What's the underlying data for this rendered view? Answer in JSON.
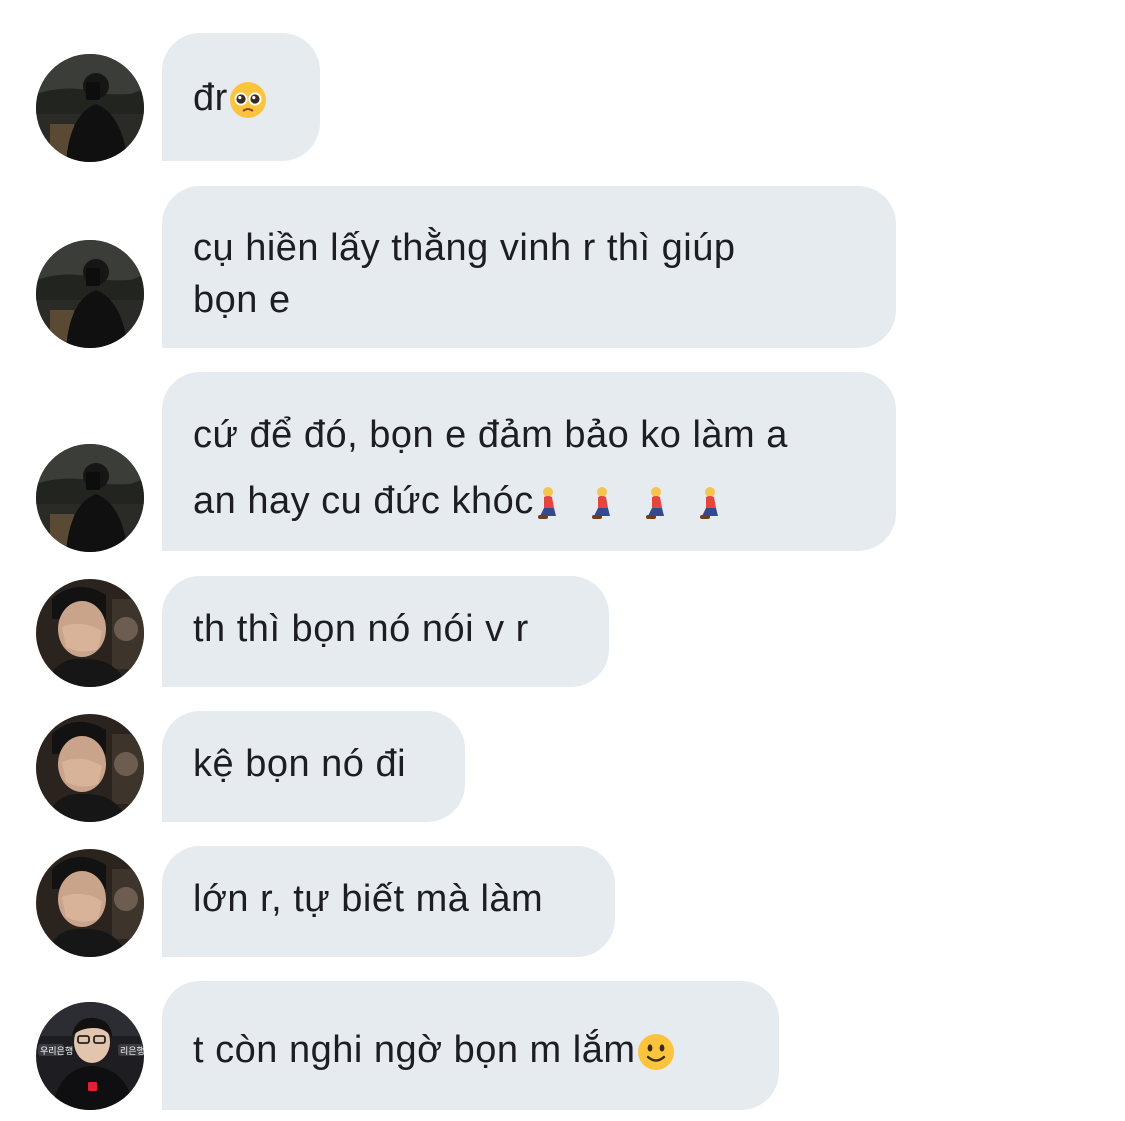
{
  "conversation": {
    "messages": [
      {
        "sender": "avatar-dark-night",
        "lines": [
          "đr"
        ],
        "emoji": "pleading-face-emoji"
      },
      {
        "sender": "avatar-dark-night",
        "lines": [
          "cụ hiền lấy thằng vinh r thì giúp",
          "bọn e"
        ]
      },
      {
        "sender": "avatar-dark-night",
        "lines": [
          "cứ để đó, bọn e đảm bảo ko làm a",
          "an hay cu đức khóc"
        ],
        "emoji": "person-kneeling-emoji",
        "emoji_count": 4
      },
      {
        "sender": "avatar-face-covered",
        "lines": [
          "th thì bọn nó nói v r"
        ]
      },
      {
        "sender": "avatar-face-covered",
        "lines": [
          "kệ bọn nó đi"
        ]
      },
      {
        "sender": "avatar-face-covered",
        "lines": [
          "lớn r, tự biết mà làm"
        ]
      },
      {
        "sender": "avatar-player-event",
        "lines": [
          "t còn nghi ngờ bọn m lắm"
        ],
        "emoji": "slightly-smiling-face-emoji"
      }
    ]
  },
  "avatar_badge_text": [
    "우리은행",
    "리은행"
  ],
  "colors": {
    "bubble": "#e6ebf0",
    "text": "#1c1e21",
    "background": "#ffffff"
  }
}
